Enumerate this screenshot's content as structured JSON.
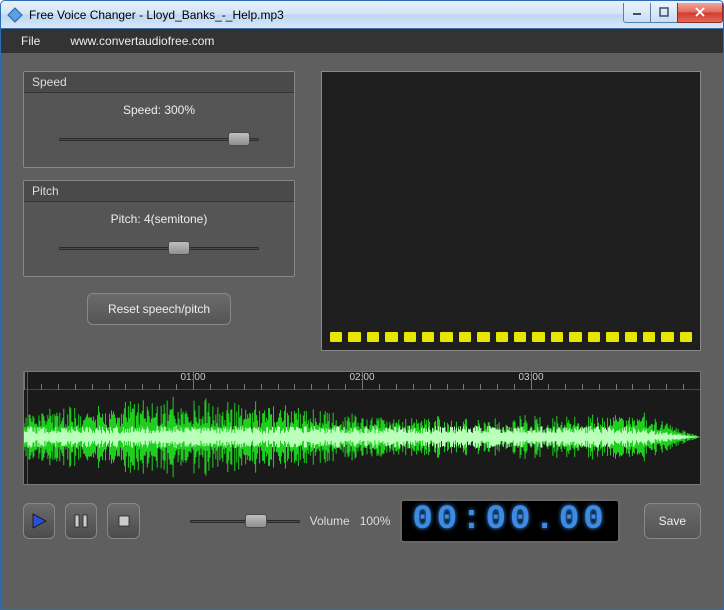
{
  "window": {
    "title": "Free Voice Changer - Lloyd_Banks_-_Help.mp3"
  },
  "menu": {
    "file": "File",
    "site": "www.convertaudiofree.com"
  },
  "speed": {
    "panel_title": "Speed",
    "value_text": "Speed: 300%",
    "percent": 90
  },
  "pitch": {
    "panel_title": "Pitch",
    "value_text": "Pitch: 4(semitone)",
    "percent": 60
  },
  "reset_label": "Reset speech/pitch",
  "ruler": {
    "marks": [
      "01:00",
      "02:00",
      "03:00"
    ]
  },
  "volume": {
    "label": "Volume",
    "value_text": "100%",
    "percent": 60
  },
  "timer": "00:00.00",
  "save_label": "Save"
}
